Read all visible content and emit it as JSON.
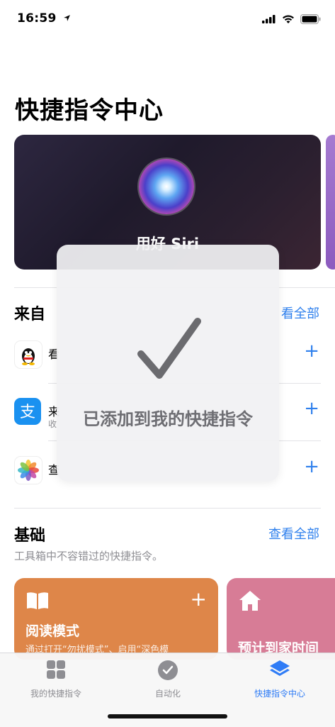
{
  "status_bar": {
    "time": "16:59"
  },
  "page_title": "快捷指令中心",
  "siri_card": {
    "title": "用好 Siri"
  },
  "from_apps": {
    "title": "来自",
    "see_all": "看全部",
    "items": [
      {
        "name": "看",
        "subtitle": "",
        "icon": "qq-penguin-icon"
      },
      {
        "name": "来",
        "subtitle": "收",
        "icon": "alipay-icon"
      },
      {
        "name": "查",
        "subtitle": "",
        "icon": "photos-icon"
      }
    ]
  },
  "basics": {
    "title": "基础",
    "see_all": "查看全部",
    "subtitle": "工具箱中不容错过的快捷指令。",
    "cards": [
      {
        "title": "阅读模式",
        "desc": "通过打开“勿扰模式”、启用“深色模",
        "icon": "book-icon",
        "color": "#de8649"
      },
      {
        "title": "预计到家时间",
        "desc": "",
        "icon": "home-icon",
        "color": "#d77c96"
      }
    ]
  },
  "overlay": {
    "message": "已添加到我的快捷指令"
  },
  "tabs": [
    {
      "label": "我的快捷指令",
      "icon": "grid-icon",
      "active": false
    },
    {
      "label": "自动化",
      "icon": "clock-check-icon",
      "active": false
    },
    {
      "label": "快捷指令中心",
      "icon": "layers-icon",
      "active": true
    }
  ]
}
